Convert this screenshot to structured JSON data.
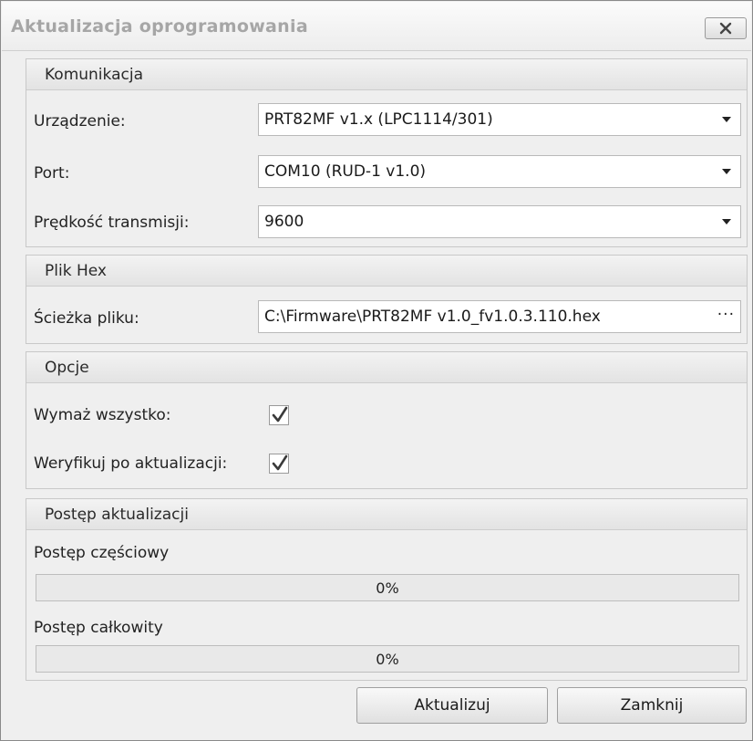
{
  "window": {
    "title": "Aktualizacja oprogramowania",
    "close_icon": "close-icon"
  },
  "communication": {
    "title": "Komunikacja",
    "device_label": "Urządzenie:",
    "device_value": "PRT82MF v1.x (LPC1114/301)",
    "port_label": "Port:",
    "port_value": "COM10 (RUD-1 v1.0)",
    "baud_label": "Prędkość transmisji:",
    "baud_value": "9600"
  },
  "hex_file": {
    "title": "Plik Hex",
    "path_label": "Ścieżka pliku:",
    "path_value": "C:\\Firmware\\PRT82MF v1.0_fv1.0.3.110.hex",
    "browse_label": "···"
  },
  "options": {
    "title": "Opcje",
    "erase_all_label": "Wymaż wszystko:",
    "erase_all_checked": true,
    "verify_label": "Weryfikuj po aktualizacji:",
    "verify_checked": true
  },
  "progress": {
    "title": "Postęp aktualizacji",
    "partial_label": "Postęp częściowy",
    "partial_value": 0,
    "partial_text": "0%",
    "total_label": "Postęp całkowity",
    "total_value": 0,
    "total_text": "0%"
  },
  "buttons": {
    "update_label": "Aktualizuj",
    "close_label": "Zamknij"
  }
}
